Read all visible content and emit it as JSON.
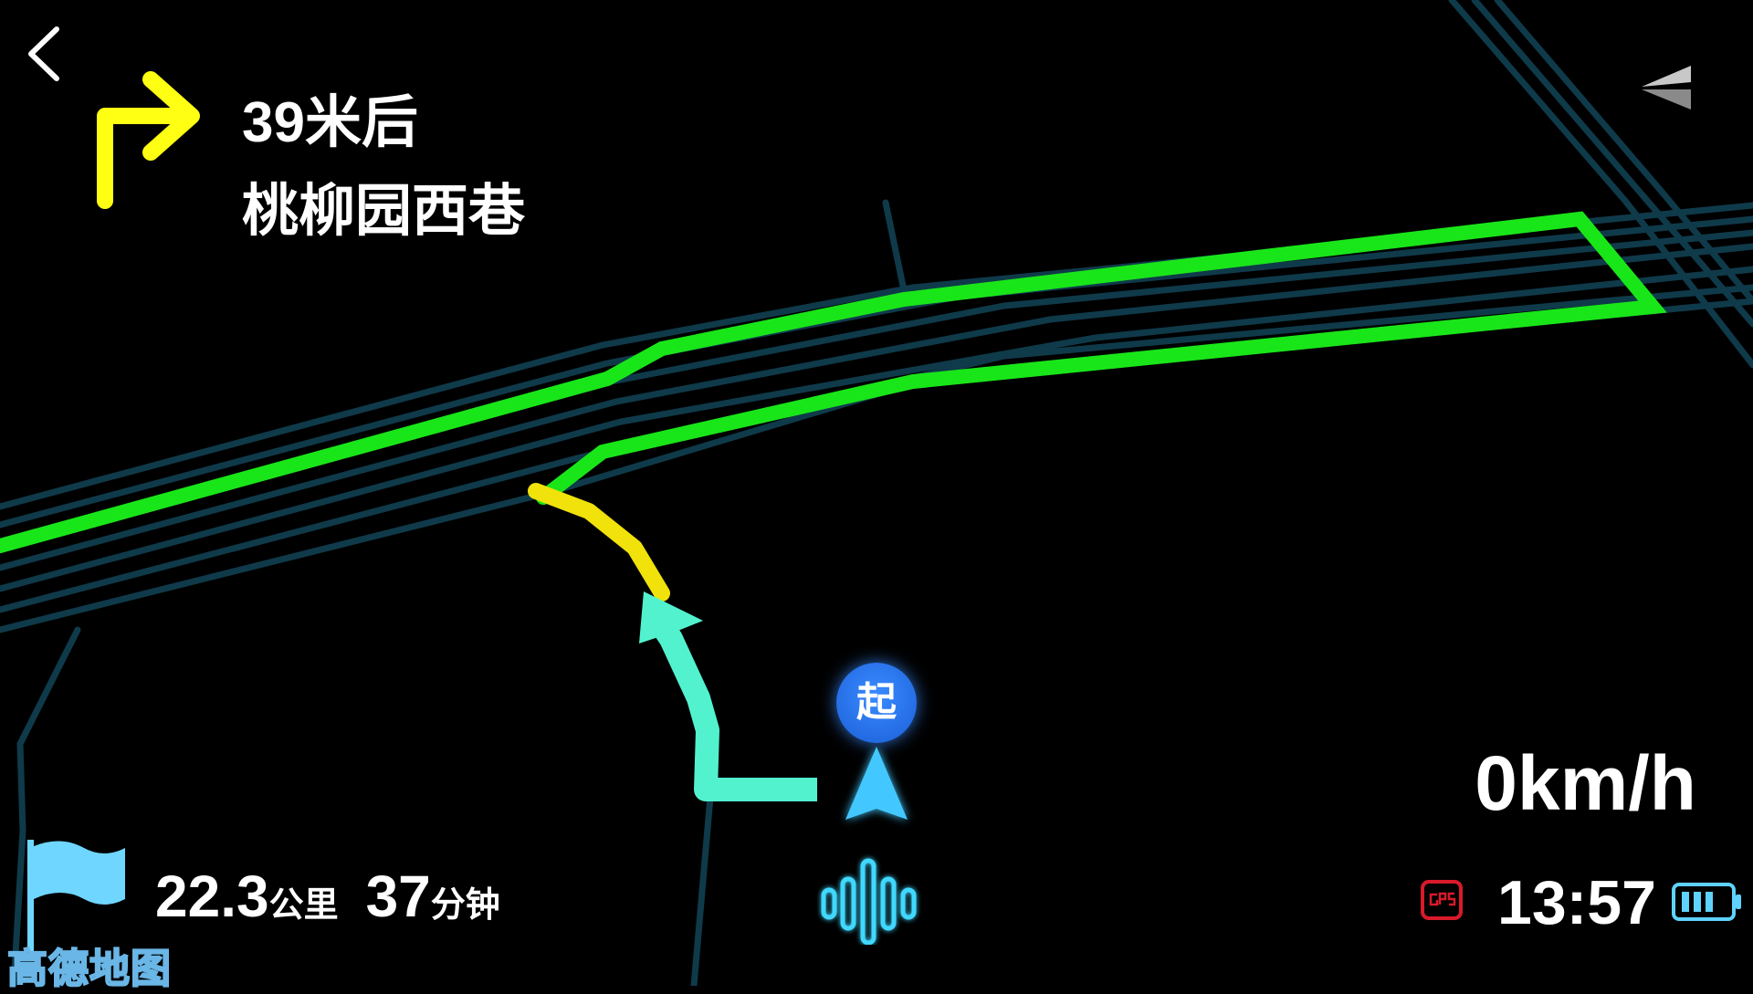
{
  "navigation": {
    "distance_text": "39米后",
    "road_name": "桃柳园西巷",
    "turn_icon": "turn-right-arrow-icon"
  },
  "status": {
    "speed": "0km/h",
    "time": "13:57",
    "gps_icon": "gps-icon",
    "battery_icon": "battery-icon"
  },
  "trip": {
    "remaining_distance": "22.3",
    "distance_unit": "公里",
    "remaining_time": "37",
    "time_unit": "分钟",
    "flag_icon": "destination-flag-icon"
  },
  "map": {
    "start_marker": "起",
    "brand": "高德地图",
    "colors": {
      "background": "#000000",
      "road": "#0f3a4a",
      "route_green": "#19e619",
      "route_yellow": "#f0e20a",
      "route_cyan": "#52f2cf",
      "car": "#43c8ff"
    }
  },
  "controls": {
    "back_icon": "back-chevron-icon",
    "view_icon": "view-mode-icon",
    "voice_icon": "voice-waveform-icon"
  }
}
